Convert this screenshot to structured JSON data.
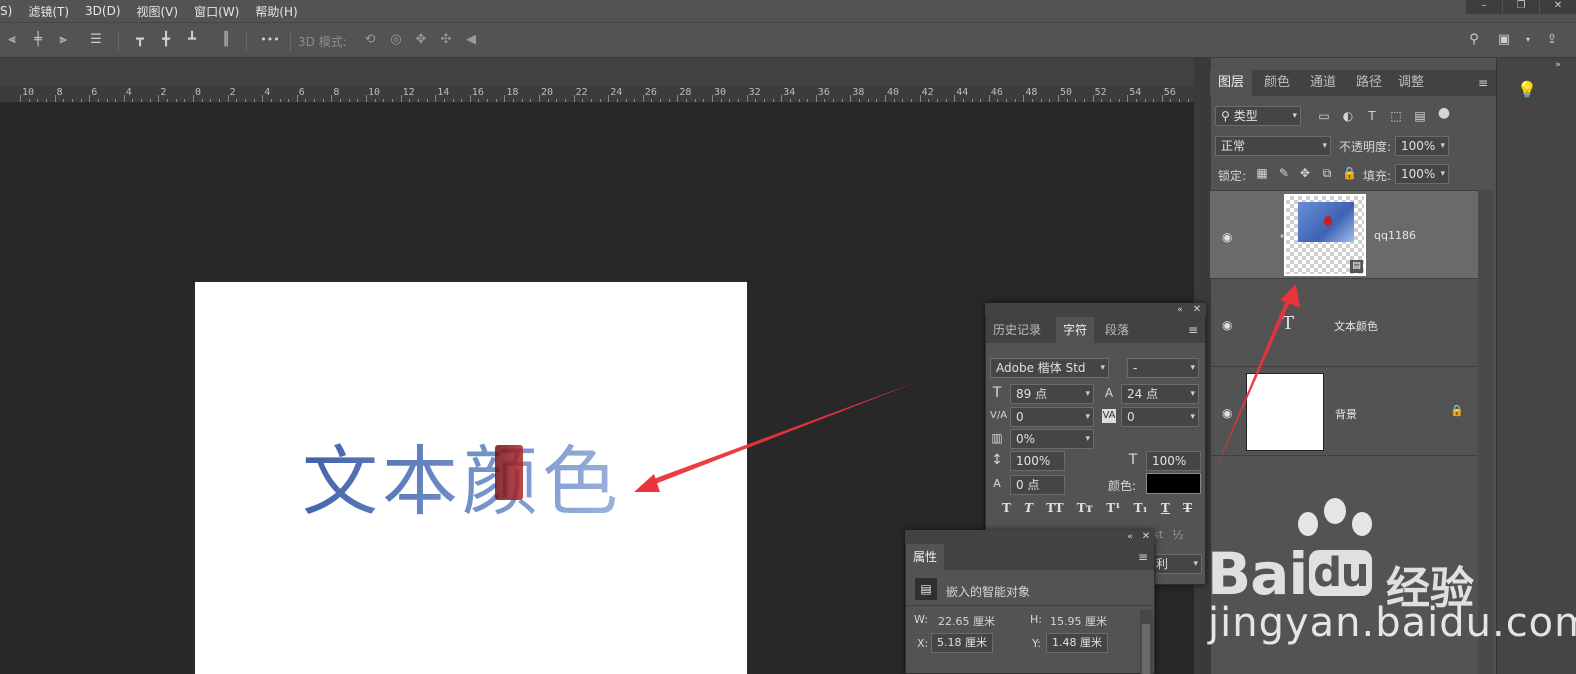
{
  "menu": {
    "items": [
      "S)",
      "滤镜(T)",
      "3D(D)",
      "视图(V)",
      "窗口(W)",
      "帮助(H)"
    ]
  },
  "window_controls": [
    "–",
    "❐",
    "✕"
  ],
  "options_bar": {
    "mode_3d_label": "3D 模式:",
    "more_label": "•••"
  },
  "ruler": {
    "labels": [
      "10",
      "8",
      "6",
      "4",
      "2",
      "0",
      "2",
      "4",
      "6",
      "8",
      "10",
      "12",
      "14",
      "16",
      "18",
      "20",
      "22",
      "24",
      "26",
      "28",
      "30",
      "32",
      "34",
      "36",
      "38",
      "40",
      "42",
      "44",
      "46",
      "48",
      "50",
      "52",
      "54",
      "56"
    ]
  },
  "canvas": {
    "text": "文本颜色"
  },
  "layers_panel": {
    "tabs": [
      "图层",
      "颜色",
      "通道",
      "路径",
      "调整"
    ],
    "active_tab": "图层",
    "filter_label": "类型",
    "blend_mode": "正常",
    "opacity_label": "不透明度:",
    "opacity_value": "100%",
    "lock_label": "锁定:",
    "fill_label": "填充:",
    "fill_value": "100%",
    "layers": [
      {
        "name": "qq1186",
        "type": "smart-object"
      },
      {
        "name": "文本颜色",
        "type": "text",
        "icon_glyph": "T"
      },
      {
        "name": "背景",
        "type": "background"
      }
    ]
  },
  "character_panel": {
    "tabs": [
      "历史记录",
      "字符",
      "段落"
    ],
    "active_tab": "字符",
    "font_family": "Adobe 楷体 Std",
    "font_style": "-",
    "font_size": "89 点",
    "leading": "24 点",
    "kerning": "0",
    "tracking": "0",
    "tsume": "0%",
    "vertical_scale": "100%",
    "horizontal_scale": "100%",
    "baseline_shift": "0 点",
    "color_label": "颜色:",
    "color_value": "#000000",
    "style_buttons": [
      "T",
      "T",
      "TT",
      "Tт",
      "T¹",
      "T₁",
      "T",
      "T"
    ],
    "partial_text": "st",
    "partial_fraction": "½",
    "partial_dropdown": "利"
  },
  "properties_panel": {
    "title": "属性",
    "object_type": "嵌入的智能对象",
    "w_label": "W:",
    "w_value": "22.65 厘米",
    "h_label": "H:",
    "h_value": "15.95 厘米",
    "x_label": "X:",
    "x_value": "5.18 厘米",
    "y_label": "Y:",
    "y_value": "1.48 厘米"
  },
  "watermark": {
    "brand": "Bai",
    "brand2": "du",
    "cn": "经验",
    "url": "jingyan.baidu.com"
  },
  "colors": {
    "annotation_arrow": "#e8343a",
    "panel_bg": "#535353",
    "canvas_text_start": "#4060a8",
    "canvas_text_end": "#9cb4dd"
  }
}
